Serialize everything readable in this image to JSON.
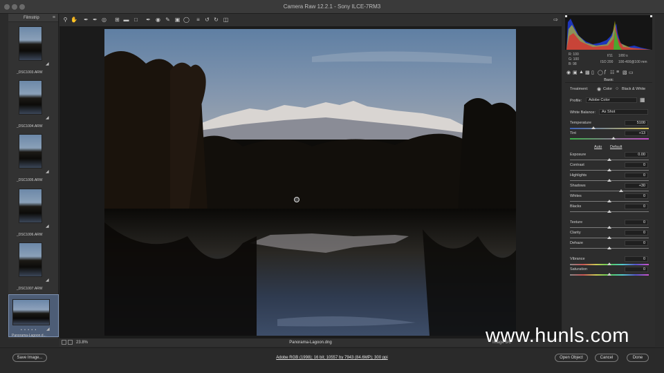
{
  "window": {
    "title": "Camera Raw 12.2.1  -  Sony ILCE-7RM3"
  },
  "filmstrip": {
    "header": "Filmstrip",
    "items": [
      {
        "label": "_DSC1003.ARW"
      },
      {
        "label": "_DSC1004.ARW"
      },
      {
        "label": "_DSC1005.ARW"
      },
      {
        "label": "_DSC1006.ARW"
      },
      {
        "label": "_DSC1007.ARW"
      },
      {
        "label": "Panorama-Lagoon.d...",
        "stars": "• • • • •",
        "selected": true
      }
    ]
  },
  "bottombar": {
    "zoom": "23.8%",
    "filename": "Panorama-Lagoon.dng",
    "view": "Image 6/6"
  },
  "watermark": "www.hunls.com",
  "readout": {
    "r": "R:  100",
    "g": "G:  100",
    "b": "B:    98",
    "aperture": "f/11",
    "shutter": "1/80 s",
    "iso": "ISO 200",
    "lens": "100-400@100 mm"
  },
  "panel": {
    "section": "Basic",
    "treatment_label": "Treatment:",
    "treatment_color": "Color",
    "treatment_bw": "Black & White",
    "profile_label": "Profile:",
    "profile_value": "Adobe Color",
    "wb_label": "White Balance:",
    "wb_value": "As Shot",
    "auto": "Auto",
    "default": "Default",
    "sliders": [
      {
        "label": "Temperature",
        "value": "5100",
        "pos": 0.3
      },
      {
        "label": "Tint",
        "value": "+13",
        "pos": 0.55
      },
      {
        "label": "Exposure",
        "value": "0.00",
        "pos": 0.5
      },
      {
        "label": "Contrast",
        "value": "0",
        "pos": 0.5
      },
      {
        "label": "Highlights",
        "value": "0",
        "pos": 0.5
      },
      {
        "label": "Shadows",
        "value": "+30",
        "pos": 0.65
      },
      {
        "label": "Whites",
        "value": "0",
        "pos": 0.5
      },
      {
        "label": "Blacks",
        "value": "0",
        "pos": 0.5
      },
      {
        "label": "Texture",
        "value": "0",
        "pos": 0.5
      },
      {
        "label": "Clarity",
        "value": "0",
        "pos": 0.5
      },
      {
        "label": "Dehaze",
        "value": "0",
        "pos": 0.5
      },
      {
        "label": "Vibrance",
        "value": "0",
        "pos": 0.5
      },
      {
        "label": "Saturation",
        "value": "0",
        "pos": 0.5
      }
    ]
  },
  "footer": {
    "save": "Save Image...",
    "info": "Adobe RGB (1998); 16 bit; 10557 by 7943 (84.6MP); 300 ppi",
    "open": "Open Object",
    "cancel": "Cancel",
    "done": "Done"
  },
  "colors": {
    "accent": "#4d5d76",
    "panel": "#2d2d2d",
    "canvas": "#1b1b1b"
  }
}
